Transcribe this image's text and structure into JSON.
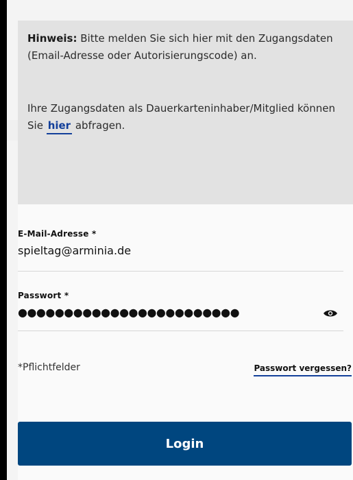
{
  "hint": {
    "label": "Hinweis:",
    "text": " Bitte melden Sie sich hier mit den Zugangsdaten (Email-Adresse oder Autorisierungscode) an.",
    "second_text": "Ihre Zugangsdaten als Dauerkarteninhaber/Mitglied können Sie ",
    "link_label": "hier",
    "second_suffix": " abfragen."
  },
  "form": {
    "email": {
      "label": "E-Mail-Adresse *",
      "value": "spieltag@arminia.de"
    },
    "password": {
      "label": "Passwort *",
      "masked_value": "●●●●●●●●●●●●●●●●●●●●●●●●",
      "toggle_icon": "eye-icon"
    },
    "required_note": "*Pflichtfelder",
    "forgot_password": "Passwort vergessen?",
    "login_label": "Login"
  },
  "colors": {
    "accent": "#00467f",
    "link": "#123f9a",
    "hint_background": "#e2e2e2",
    "page_background": "#000000"
  }
}
